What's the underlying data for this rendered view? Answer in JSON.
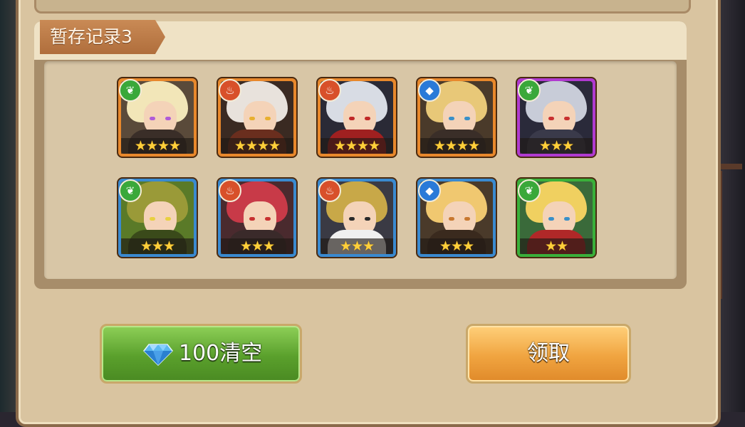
{
  "record": {
    "tag_label": "暂存记录3"
  },
  "heroes": [
    {
      "element": "nature",
      "element_icon": "leaf-icon",
      "stars": "★★★★",
      "stars_count": 4,
      "frame_color": "#e8882c",
      "hair": "#f2e6b8",
      "body": "#3a2e28",
      "eye": "#b05ad8",
      "bg": "#5a4a3a"
    },
    {
      "element": "fire",
      "element_icon": "flame-icon",
      "stars": "★★★★",
      "stars_count": 4,
      "frame_color": "#e8882c",
      "hair": "#e8e2dc",
      "body": "#6a2e1e",
      "eye": "#e8b030",
      "bg": "#3a2a22"
    },
    {
      "element": "fire",
      "element_icon": "flame-icon",
      "stars": "★★★★",
      "stars_count": 4,
      "frame_color": "#e8882c",
      "hair": "#d8dce4",
      "body": "#a02020",
      "eye": "#c02828",
      "bg": "#2a2a36"
    },
    {
      "element": "water",
      "element_icon": "water-drop-icon",
      "stars": "★★★★",
      "stars_count": 4,
      "frame_color": "#e8882c",
      "hair": "#e8c878",
      "body": "#3a2e28",
      "eye": "#3a90c8",
      "bg": "#4a3a2a"
    },
    {
      "element": "nature",
      "element_icon": "leaf-icon",
      "stars": "★★★",
      "stars_count": 3,
      "frame_color": "#b03ad0",
      "hair": "#c8ccd8",
      "body": "#3a3a4a",
      "eye": "#c83030",
      "bg": "#2a2a3a"
    },
    {
      "element": "nature",
      "element_icon": "leaf-icon",
      "stars": "★★★",
      "stars_count": 3,
      "frame_color": "#3a8ad0",
      "hair": "#9a9a38",
      "body": "#3a4a1a",
      "eye": "#e8d040",
      "bg": "#5a7a28"
    },
    {
      "element": "fire",
      "element_icon": "flame-icon",
      "stars": "★★★",
      "stars_count": 3,
      "frame_color": "#3a8ad0",
      "hair": "#c83a48",
      "body": "#3a2a2a",
      "eye": "#c83030",
      "bg": "#4a2a2e"
    },
    {
      "element": "fire",
      "element_icon": "flame-icon",
      "stars": "★★★",
      "stars_count": 3,
      "frame_color": "#3a8ad0",
      "hair": "#c8a848",
      "body": "#f0f0f0",
      "eye": "#2a2a2a",
      "bg": "#3a3a44"
    },
    {
      "element": "water",
      "element_icon": "water-drop-icon",
      "stars": "★★★",
      "stars_count": 3,
      "frame_color": "#3a8ad0",
      "hair": "#f0c870",
      "body": "#3a2a1e",
      "eye": "#c87830",
      "bg": "#4a3a2a"
    },
    {
      "element": "nature",
      "element_icon": "leaf-icon",
      "stars": "★★",
      "stars_count": 2,
      "frame_color": "#3ab03a",
      "hair": "#f0d060",
      "body": "#b02828",
      "eye": "#3a90c8",
      "bg": "#3a6a3a"
    }
  ],
  "buttons": {
    "clear_label": "100清空",
    "clear_icon": "diamond-icon",
    "claim_label": "领取"
  },
  "colors": {
    "nature": "#3aa83a",
    "fire": "#d8502a",
    "water": "#2a7ad8"
  }
}
